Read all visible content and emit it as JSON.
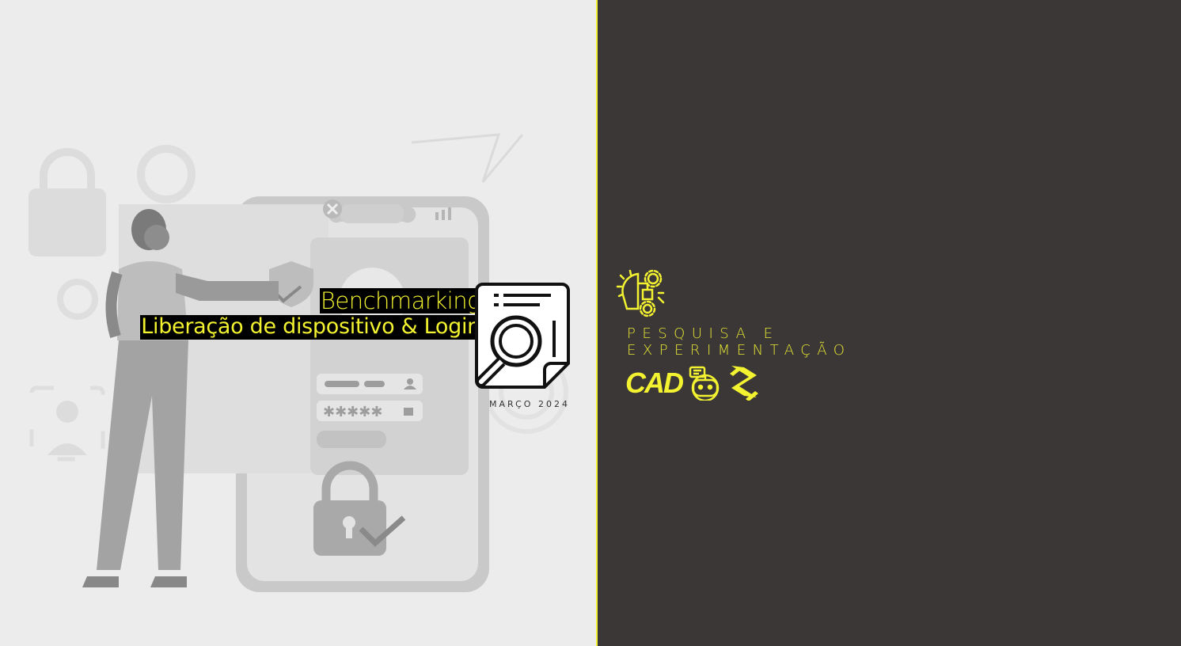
{
  "title": "Benchmarking",
  "subtitle": "Liberação de dispositivo & Login",
  "date": "MARÇO 2024",
  "brand": {
    "line1": "PESQUISA E",
    "line2": "EXPERIMENTAÇÃO",
    "logo_text": "CAD"
  },
  "icons": {
    "report": "magnifier-report-icon",
    "brand": "brain-gears-icon",
    "bot": "chatbot-icon",
    "bank": "bank-logo-icon"
  },
  "colors": {
    "accent": "#f2f230",
    "right_bg": "#3b3736",
    "left_bg": "#ececec",
    "title_bg": "#000000"
  }
}
